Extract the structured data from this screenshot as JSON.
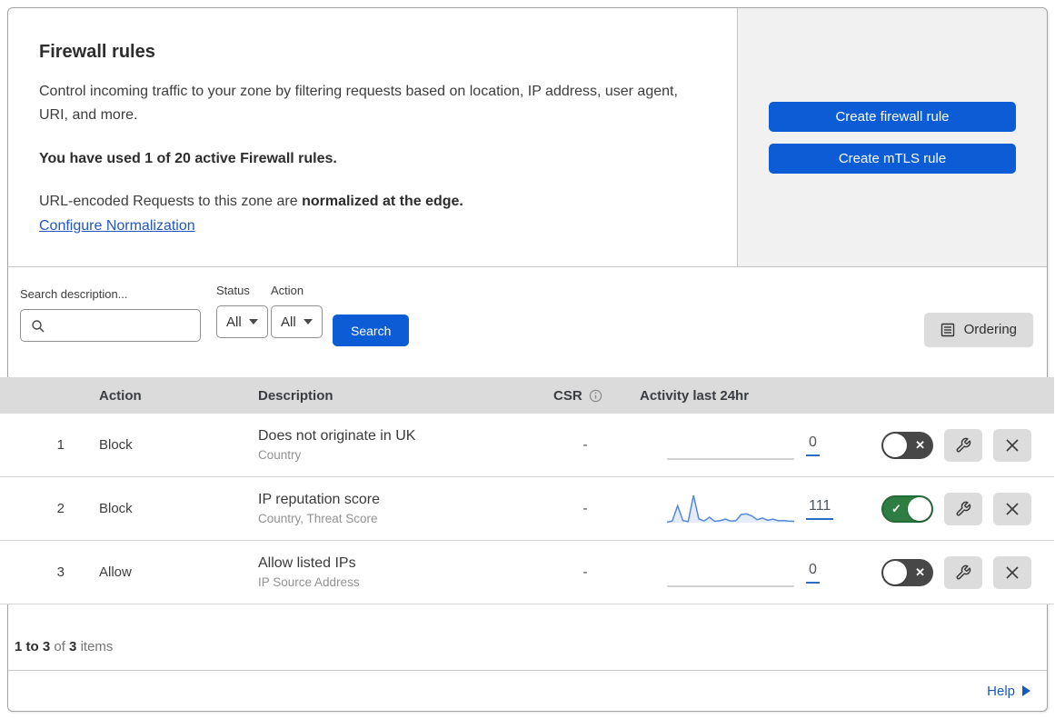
{
  "header": {
    "title": "Firewall rules",
    "description": "Control incoming traffic to your zone by filtering requests based on location, IP address, user agent, URI, and more.",
    "usage_summary": "You have used 1 of 20 active Firewall rules.",
    "normalization_prefix": "URL-encoded Requests to this zone are ",
    "normalization_bold": "normalized at the edge.",
    "normalization_link": "Configure Normalization",
    "create_firewall_button": "Create firewall rule",
    "create_mtls_button": "Create mTLS rule"
  },
  "filters": {
    "search_label": "Search description...",
    "status_label": "Status",
    "status_value": "All",
    "action_label": "Action",
    "action_value": "All",
    "search_button": "Search",
    "ordering_button": "Ordering"
  },
  "table": {
    "columns": {
      "action": "Action",
      "description": "Description",
      "csr": "CSR",
      "activity": "Activity last 24hr"
    },
    "rows": [
      {
        "index": "1",
        "action": "Block",
        "description": "Does not originate in UK",
        "fields": "Country",
        "csr": "-",
        "activity_count": "0",
        "enabled": false,
        "sparkline": [
          0,
          0,
          0,
          0,
          0,
          0,
          0,
          0,
          0,
          0,
          0,
          0,
          0,
          0,
          0,
          0,
          0,
          0,
          0,
          0,
          0,
          0,
          0,
          0,
          0
        ]
      },
      {
        "index": "2",
        "action": "Block",
        "description": "IP reputation score",
        "fields": "Country, Threat Score",
        "csr": "-",
        "activity_count": "111",
        "enabled": true,
        "sparkline": [
          2,
          6,
          62,
          8,
          4,
          100,
          14,
          6,
          20,
          5,
          7,
          13,
          6,
          7,
          30,
          32,
          25,
          11,
          17,
          9,
          13,
          7,
          8,
          6,
          5
        ]
      },
      {
        "index": "3",
        "action": "Allow",
        "description": "Allow listed IPs",
        "fields": "IP Source Address",
        "csr": "-",
        "activity_count": "0",
        "enabled": false,
        "sparkline": [
          0,
          0,
          0,
          0,
          0,
          0,
          0,
          0,
          0,
          0,
          0,
          0,
          0,
          0,
          0,
          0,
          0,
          0,
          0,
          0,
          0,
          0,
          0,
          0,
          0
        ]
      }
    ]
  },
  "footer": {
    "range": "1 to 3",
    "of_text": "of",
    "total": "3",
    "items_text": "items",
    "help_link": "Help"
  },
  "colors": {
    "accent_blue": "#0b5cd5",
    "link_blue": "#2257bd",
    "toggle_on_green": "#2e7d42",
    "toggle_off_gray": "#474747",
    "sparkline_blue": "#5488d8",
    "header_band_gray": "#dbdbdb",
    "panel_gray": "#f1f1f1"
  }
}
